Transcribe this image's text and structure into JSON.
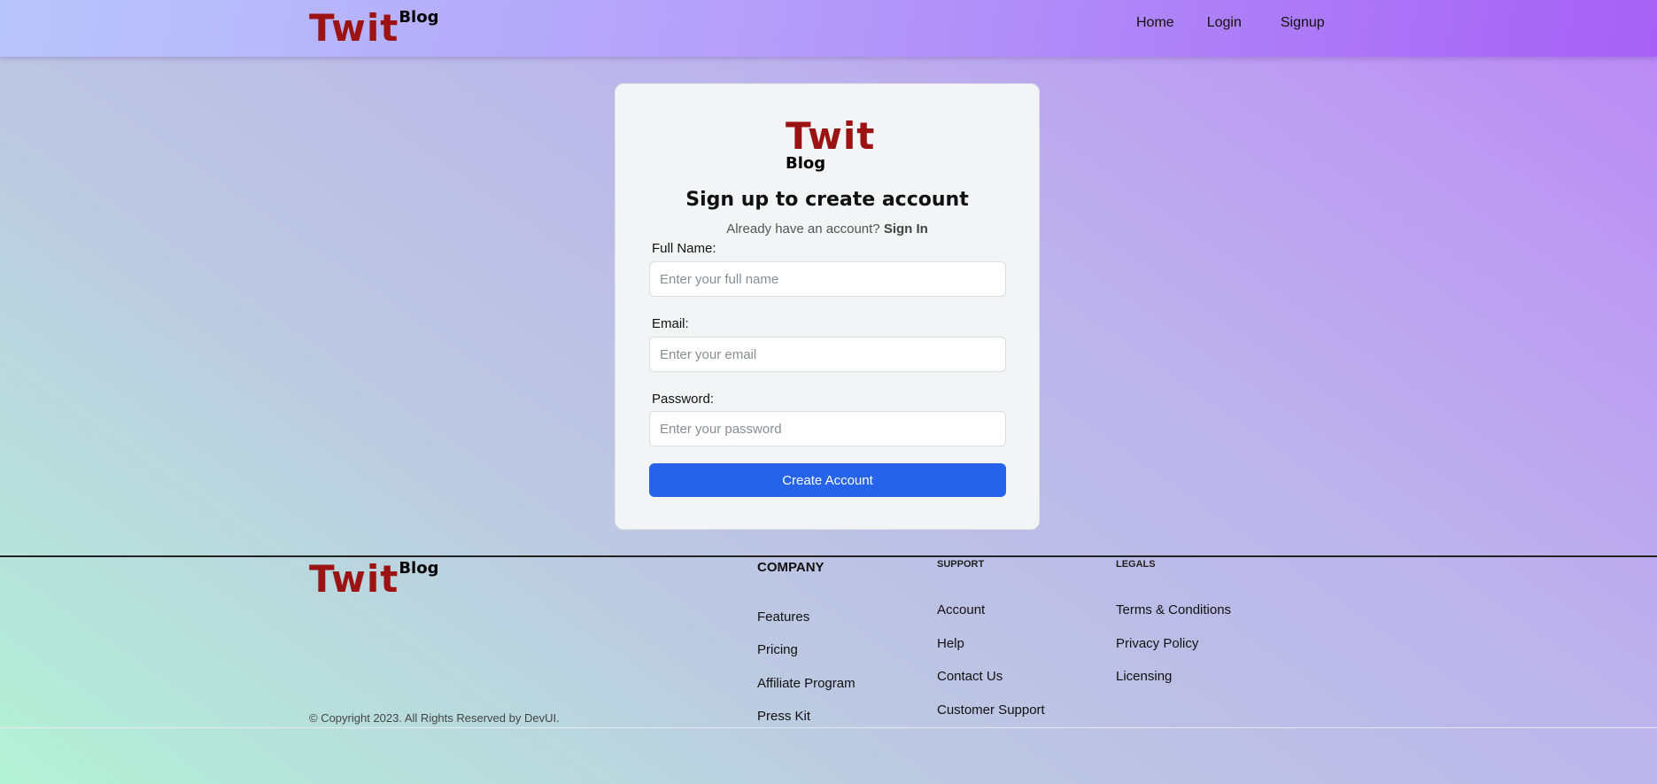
{
  "brand": {
    "twit": "Twit",
    "blog": "Blog"
  },
  "nav": {
    "home": "Home",
    "login": "Login",
    "signup": "Signup"
  },
  "card": {
    "title": "Sign up to create account",
    "already": "Already have an account?",
    "signin": "Sign In",
    "fields": {
      "fullname": {
        "label": "Full Name:",
        "placeholder": "Enter your full name",
        "value": ""
      },
      "email": {
        "label": "Email:",
        "placeholder": "Enter your email",
        "value": ""
      },
      "password": {
        "label": "Password:",
        "placeholder": "Enter your password",
        "value": ""
      }
    },
    "button": "Create Account"
  },
  "footer": {
    "copyright": "© Copyright 2023. All Rights Reserved by DevUI.",
    "company": {
      "heading": "COMPANY",
      "links": [
        "Features",
        "Pricing",
        "Affiliate Program",
        "Press Kit"
      ]
    },
    "support": {
      "heading": "SUPPORT",
      "links": [
        "Account",
        "Help",
        "Contact Us",
        "Customer Support"
      ]
    },
    "legals": {
      "heading": "LEGALS",
      "links": [
        "Terms & Conditions",
        "Privacy Policy",
        "Licensing"
      ]
    }
  },
  "colors": {
    "brand_red": "#9b1313",
    "button_blue": "#2563eb",
    "header_purple": "#a660f5"
  }
}
